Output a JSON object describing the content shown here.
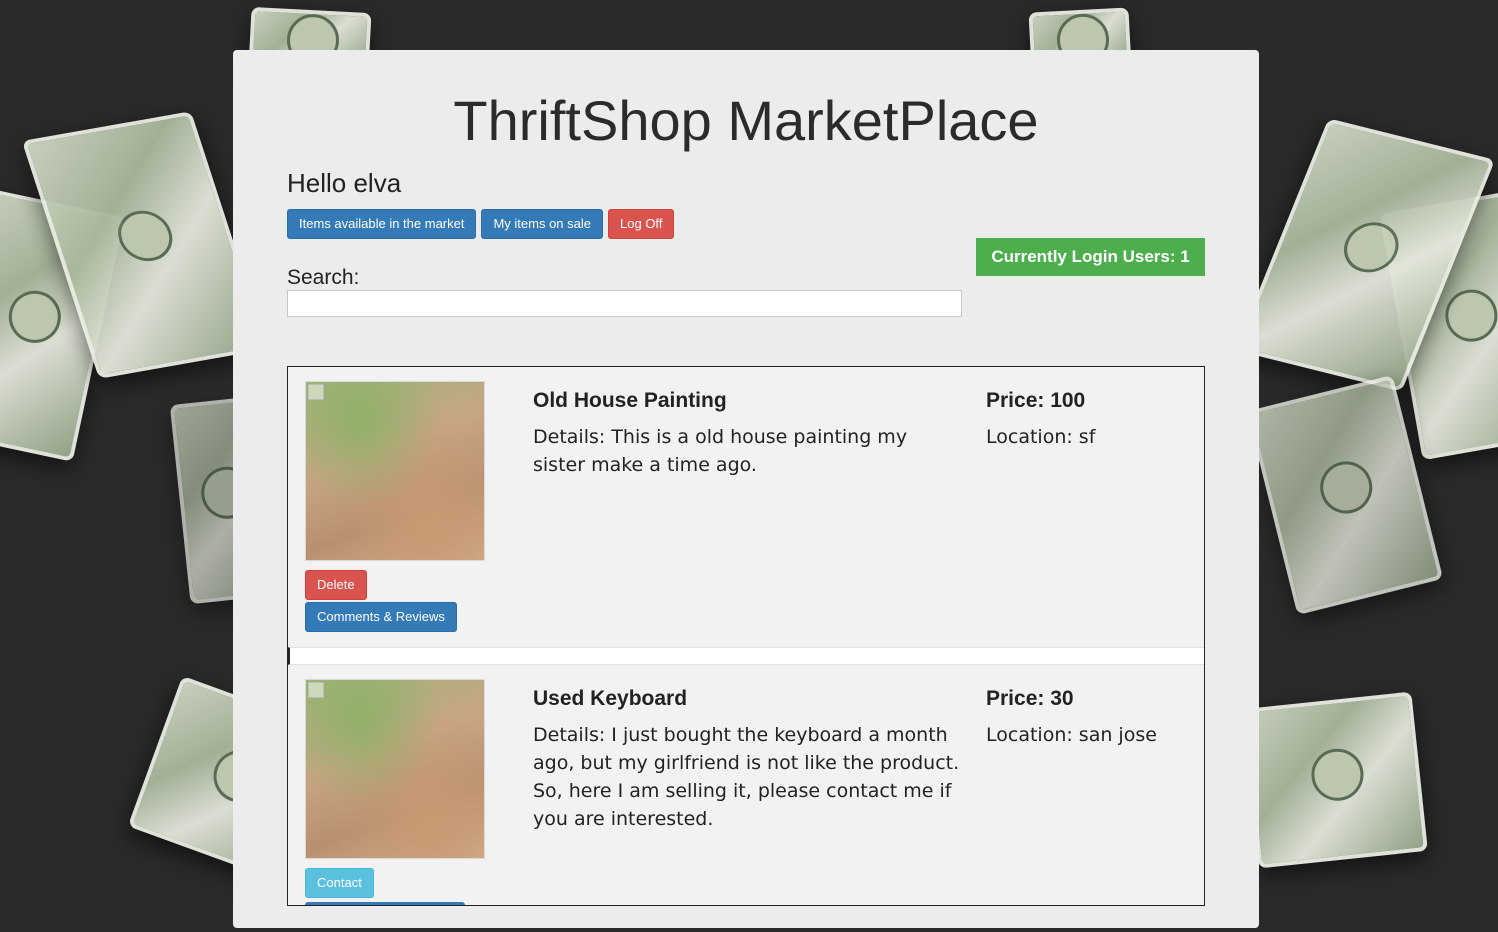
{
  "site": {
    "title": "ThriftShop MarketPlace"
  },
  "user": {
    "greeting": "Hello elva"
  },
  "nav": {
    "market_label": "Items available in the market",
    "my_items_label": "My items on sale",
    "logoff_label": "Log Off"
  },
  "status": {
    "login_users": "Currently Login Users: 1"
  },
  "search": {
    "label": "Search:",
    "value": "",
    "placeholder": ""
  },
  "items": [
    {
      "title": "Old House Painting",
      "details": "Details: This is a old house painting my sister make a time ago.",
      "price": "Price: 100",
      "location": "Location: sf",
      "primary_action": "Delete",
      "secondary_action": "Comments & Reviews"
    },
    {
      "title": "Used Keyboard",
      "details": "Details: I just bought the keyboard a month ago, but my girlfriend is not like the product. So, here I am selling it, please contact me if you are interested.",
      "price": "Price: 30",
      "location": "Location: san jose",
      "primary_action": "Contact"
    }
  ],
  "colors": {
    "primary": "#337ab7",
    "danger": "#d9534f",
    "info": "#5bc0de",
    "success": "#4cae4c",
    "page_background": "#2a2a2a",
    "panel_background": "#ececec"
  }
}
